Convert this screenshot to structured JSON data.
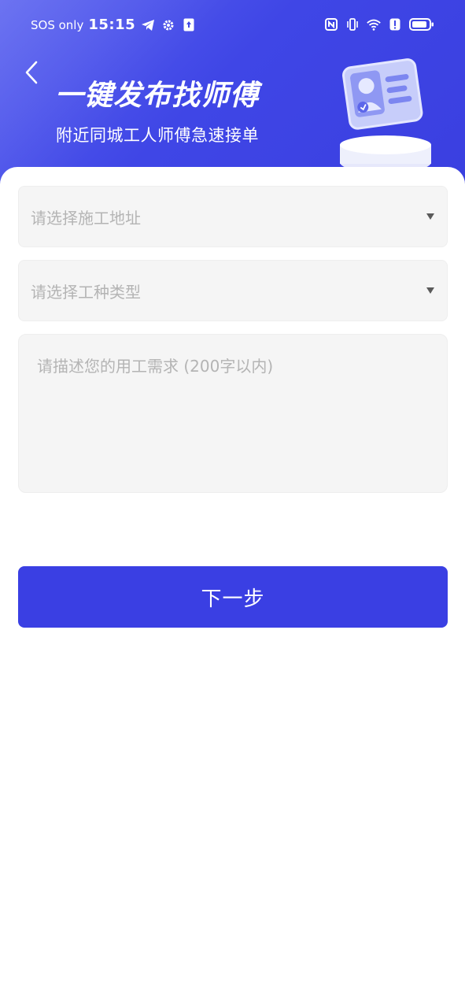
{
  "statusbar": {
    "carrier": "SOS only",
    "time": "15:15",
    "left_icons": [
      "telegram-icon",
      "gear-icon",
      "upload-icon"
    ],
    "right_icons": [
      "nfc-icon",
      "vibrate-icon",
      "wifi-icon",
      "alert-icon",
      "battery-icon"
    ]
  },
  "header": {
    "title": "一键发布找师傅",
    "subtitle": "附近同城工人师傅急速接单"
  },
  "form": {
    "address_placeholder": "请选择施工地址",
    "worktype_placeholder": "请选择工种类型",
    "description_placeholder": "请描述您的用工需求 (200字以内)"
  },
  "actions": {
    "next_label": "下一步"
  },
  "colors": {
    "primary": "#3a3fe3",
    "field_bg": "#f5f5f5",
    "placeholder": "#b4b4b4"
  }
}
